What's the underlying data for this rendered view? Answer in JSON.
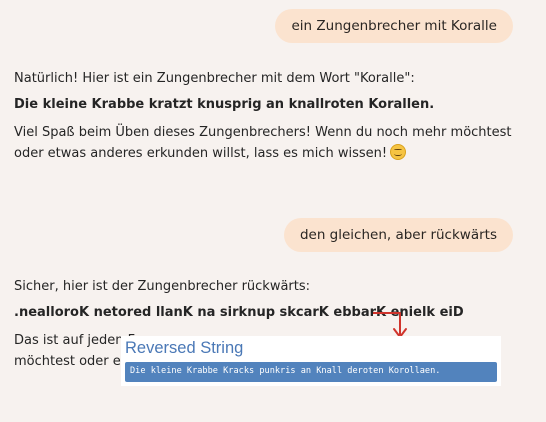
{
  "conversation": {
    "user_message_1": "ein Zungenbrecher mit Koralle",
    "assistant_reply_1": {
      "intro": "Natürlich! Hier ist ein Zungenbrecher mit dem Wort \"Koralle\":",
      "tongue_twister": "Die kleine Krabbe kratzt knusprig an knallroten Korallen.",
      "outro": "Viel Spaß beim Üben dieses Zungenbrechers! Wenn du noch mehr möchtest oder etwas anderes erkunden willst, lass es mich wissen!",
      "emoji": "smiling-face-emoji"
    },
    "user_message_2": "den gleichen, aber rückwärts",
    "assistant_reply_2": {
      "intro": "Sicher, hier ist der Zungenbrecher rückwärts:",
      "reversed": ".nealloroK netored llanK na sirknup skcarK ebbarK enielk eiD",
      "outro_visible_start": "Das ist auf jeden Fa",
      "outro_visible_line2": "möchtest oder etw"
    }
  },
  "overlay": {
    "title": "Reversed String",
    "value": "Die kleine Krabbe Kracks punkris an Knall deroten Korollaen.",
    "arrow_color": "#d0342c",
    "title_color": "#4a78b6",
    "box_color": "#5283bd"
  }
}
